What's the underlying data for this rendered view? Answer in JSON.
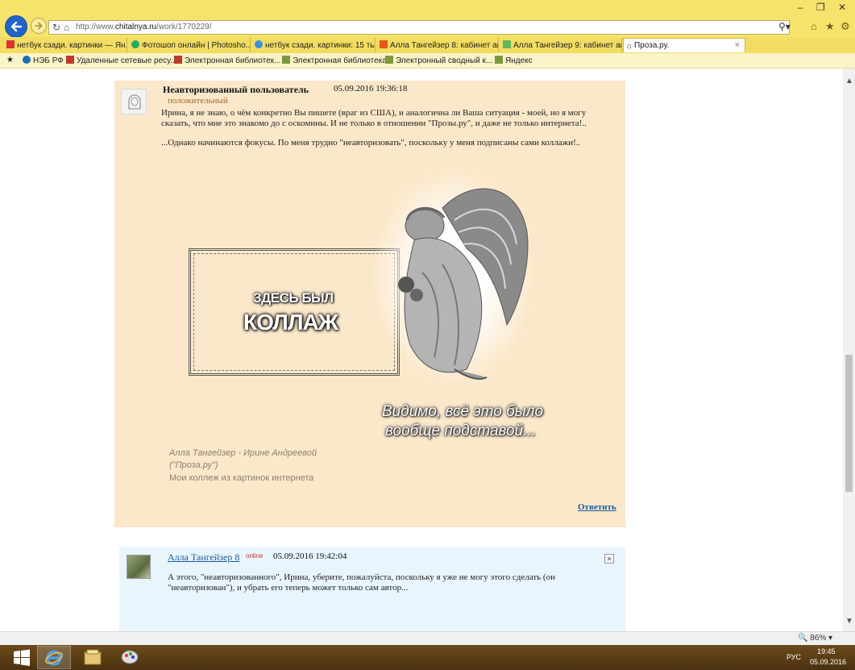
{
  "browser": {
    "url_prefix": "http://www.",
    "url_domain": "chitalnya.ru",
    "url_path": "/work/1770229/",
    "search_icon": "search-icon",
    "tabs": [
      {
        "label": "нетбук сзади. картинки — Ян...",
        "icon_color": "#d33"
      },
      {
        "label": "Фотошоп онлайн | Photosho...",
        "icon_color": "#2a6"
      },
      {
        "label": "нетбук сзади. картинки: 15 ты...",
        "icon_color": "#3a8ee6"
      },
      {
        "label": "Алла Тангейзер 8: кабинет ав...",
        "icon_color": "#e8561a"
      },
      {
        "label": "Алла Тангейзер 9: кабинет ав...",
        "icon_color": "#5cb85c"
      },
      {
        "label": "Проза.ру.",
        "icon_color": "#555",
        "close": "×"
      }
    ],
    "favorites": [
      {
        "label": "НЭБ РФ",
        "icon_color": "#1e6fb5"
      },
      {
        "label": "Удаленные сетевые ресу...",
        "icon_color": "#c0392b"
      },
      {
        "label": "Электронная библиотек...",
        "icon_color": "#c0392b"
      },
      {
        "label": "Электронная библиотека",
        "icon_color": "#7a9a3a"
      },
      {
        "label": "Электронный сводный к...",
        "icon_color": "#7a9a3a"
      },
      {
        "label": "Яндекс",
        "icon_color": "#7a9a3a"
      }
    ],
    "zoom": "86%"
  },
  "comments": [
    {
      "author": "Неавторизованный пользователь",
      "date": "05.09.2016   19:36:18",
      "status": "положительный",
      "text_lines": [
        "Ирина, я не знаю, о чём конкретно Вы пишете (враг из США), и аналогична ли Ваша ситуация - моей, но я могу",
        "сказать, что мне это знакомо до с оскомины. И не только в отношении \"Прозы.ру\", и даже не только интернета!..",
        "...Однако начинаются фокусы. По меня трудно \"неавторизовать\", поскольку у меня подписаны сами коллажи!.."
      ],
      "collage": {
        "line1": "ЗДЕСЬ БЫЛ",
        "line2": "КОЛЛАЖ",
        "tagline1": "Видимо, всё это было",
        "tagline2": "вообще подставой...",
        "caption1": "Алла Тангейзер - Ирине Андреевой",
        "caption2": "(\"Проза.ру\")",
        "caption3": "Мои коллеж из картинок интернета"
      },
      "reply_label": "Ответить"
    },
    {
      "author": "Алла Тангейзер 8",
      "online": "online",
      "date": "05.09.2016   19:42:04",
      "close": "×",
      "text_lines": [
        "А этого, \"неавторизованного\", Ирина, уберите, пожалуйста, поскольку я уже не могу этого сделать (он",
        "\"неавторизован\"), и убрать его теперь может только сам автор..."
      ]
    }
  ],
  "taskbar": {
    "lang": "РУС",
    "time": "19:45",
    "date": "05.09.2016"
  }
}
